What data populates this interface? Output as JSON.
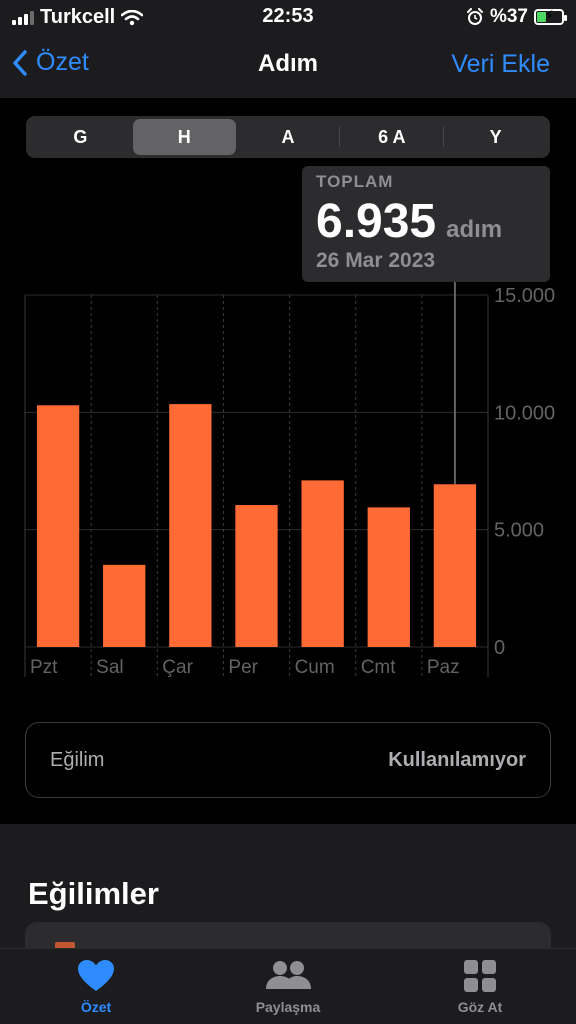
{
  "status_bar": {
    "carrier": "Turkcell",
    "time": "22:53",
    "battery_text": "%37",
    "battery_level": 0.37,
    "icons": [
      "signal-icon",
      "wifi-icon",
      "alarm-icon",
      "battery-charging-icon"
    ]
  },
  "nav": {
    "back_label": "Özet",
    "title": "Adım",
    "action_label": "Veri Ekle"
  },
  "segments": [
    {
      "label": "G",
      "active": false
    },
    {
      "label": "H",
      "active": true
    },
    {
      "label": "A",
      "active": false
    },
    {
      "label": "6 A",
      "active": false
    },
    {
      "label": "Y",
      "active": false
    }
  ],
  "tooltip": {
    "label": "TOPLAM",
    "value": "6.935",
    "unit": "adım",
    "date": "26 Mar 2023"
  },
  "chart_data": {
    "type": "bar",
    "categories": [
      "Pzt",
      "Sal",
      "Çar",
      "Per",
      "Cum",
      "Cmt",
      "Paz"
    ],
    "values": [
      10300,
      3500,
      10350,
      6050,
      7100,
      5950,
      6935
    ],
    "ylim": [
      0,
      15000
    ],
    "y_ticks": [
      0,
      5000,
      10000,
      15000
    ],
    "y_tick_labels": [
      "0",
      "5.000",
      "10.000",
      "15.000"
    ],
    "bar_color": "#ff6a35",
    "selected_index": 6,
    "grid": true
  },
  "trend_card": {
    "label": "Eğilim",
    "value": "Kullanılamıyor"
  },
  "section": {
    "title": "Eğilimler"
  },
  "tabs": [
    {
      "label": "Özet",
      "icon": "heart-icon",
      "active": true
    },
    {
      "label": "Paylaşma",
      "icon": "people-icon",
      "active": false
    },
    {
      "label": "Göz At",
      "icon": "grid-icon",
      "active": false
    }
  ],
  "colors": {
    "accent": "#2f8cff",
    "bar": "#ff6a35",
    "background": "#000000",
    "surface": "#1c1c1e"
  }
}
